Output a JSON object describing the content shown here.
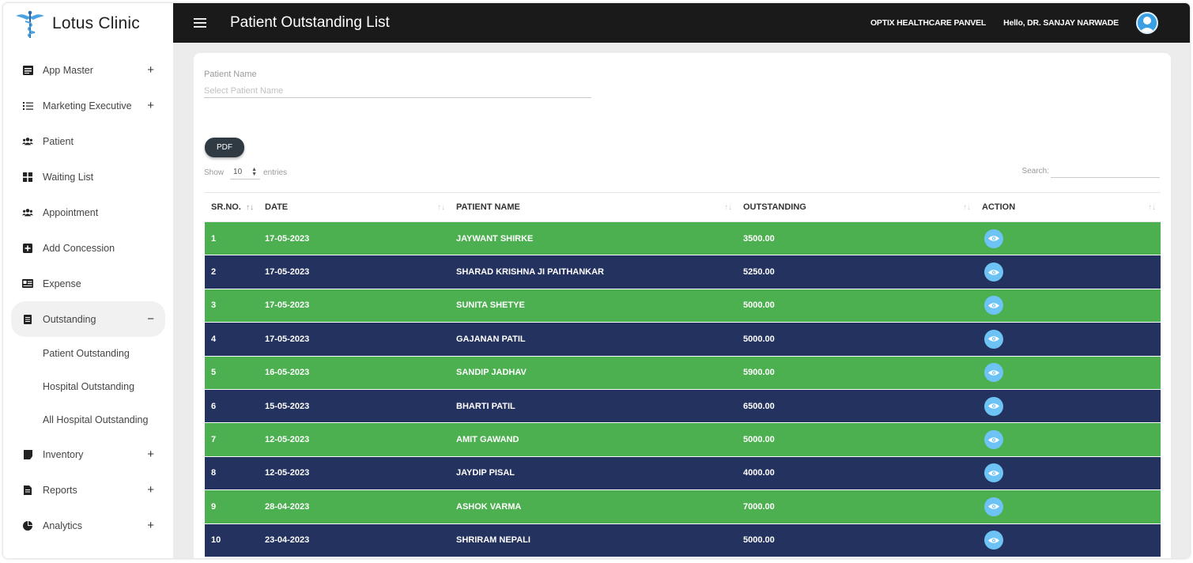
{
  "brand": {
    "name": "Lotus Clinic"
  },
  "header": {
    "title": "Patient Outstanding List",
    "panel": "OPTIX HEALTHCARE PANVEL",
    "greeting": "Hello, DR. SANJAY NARWADE"
  },
  "sidebar": {
    "items": [
      {
        "label": "App Master",
        "icon": "list-box-icon",
        "ctrl": "+"
      },
      {
        "label": "Marketing Executive",
        "icon": "checklist-icon",
        "ctrl": "+"
      },
      {
        "label": "Patient",
        "icon": "users-icon",
        "ctrl": ""
      },
      {
        "label": "Waiting List",
        "icon": "grid-icon",
        "ctrl": ""
      },
      {
        "label": "Appointment",
        "icon": "users-icon",
        "ctrl": ""
      },
      {
        "label": "Add Concession",
        "icon": "plus-square-icon",
        "ctrl": ""
      },
      {
        "label": "Expense",
        "icon": "card-icon",
        "ctrl": ""
      },
      {
        "label": "Outstanding",
        "icon": "document-icon",
        "ctrl": "−"
      }
    ],
    "subitems": [
      "Patient Outstanding",
      "Hospital Outstanding",
      "All Hospital Outstanding"
    ],
    "items_after": [
      {
        "label": "Inventory",
        "icon": "box-icon",
        "ctrl": "+"
      },
      {
        "label": "Reports",
        "icon": "report-icon",
        "ctrl": "+"
      },
      {
        "label": "Analytics",
        "icon": "pie-icon",
        "ctrl": "+"
      }
    ]
  },
  "filter": {
    "label": "Patient Name",
    "placeholder": "Select Patient Name"
  },
  "pdf_label": "PDF",
  "length": {
    "show": "Show",
    "value": "10",
    "entries": "entries"
  },
  "search_label": "Search:",
  "table": {
    "headers": [
      "SR.NO.",
      "DATE",
      "PATIENT NAME",
      "OUTSTANDING",
      "ACTION"
    ],
    "rows": [
      {
        "sr": "1",
        "date": "17-05-2023",
        "name": "JAYWANT SHIRKE",
        "amount": "3500.00"
      },
      {
        "sr": "2",
        "date": "17-05-2023",
        "name": "SHARAD KRISHNA JI PAITHANKAR",
        "amount": "5250.00"
      },
      {
        "sr": "3",
        "date": "17-05-2023",
        "name": "SUNITA SHETYE",
        "amount": "5000.00"
      },
      {
        "sr": "4",
        "date": "17-05-2023",
        "name": "GAJANAN PATIL",
        "amount": "5000.00"
      },
      {
        "sr": "5",
        "date": "16-05-2023",
        "name": "SANDIP JADHAV",
        "amount": "5900.00"
      },
      {
        "sr": "6",
        "date": "15-05-2023",
        "name": "BHARTI PATIL",
        "amount": "6500.00"
      },
      {
        "sr": "7",
        "date": "12-05-2023",
        "name": "AMIT GAWAND",
        "amount": "5000.00"
      },
      {
        "sr": "8",
        "date": "12-05-2023",
        "name": "JAYDIP PISAL",
        "amount": "4000.00"
      },
      {
        "sr": "9",
        "date": "28-04-2023",
        "name": "ASHOK VARMA",
        "amount": "7000.00"
      },
      {
        "sr": "10",
        "date": "23-04-2023",
        "name": "SHRIRAM NEPALI",
        "amount": "5000.00"
      }
    ]
  },
  "colors": {
    "topbar": "#1a1a1a",
    "row_green": "#4caf50",
    "row_navy": "#24325f",
    "action_button": "#6ec3f5",
    "pdf_button": "#2f3a43"
  }
}
